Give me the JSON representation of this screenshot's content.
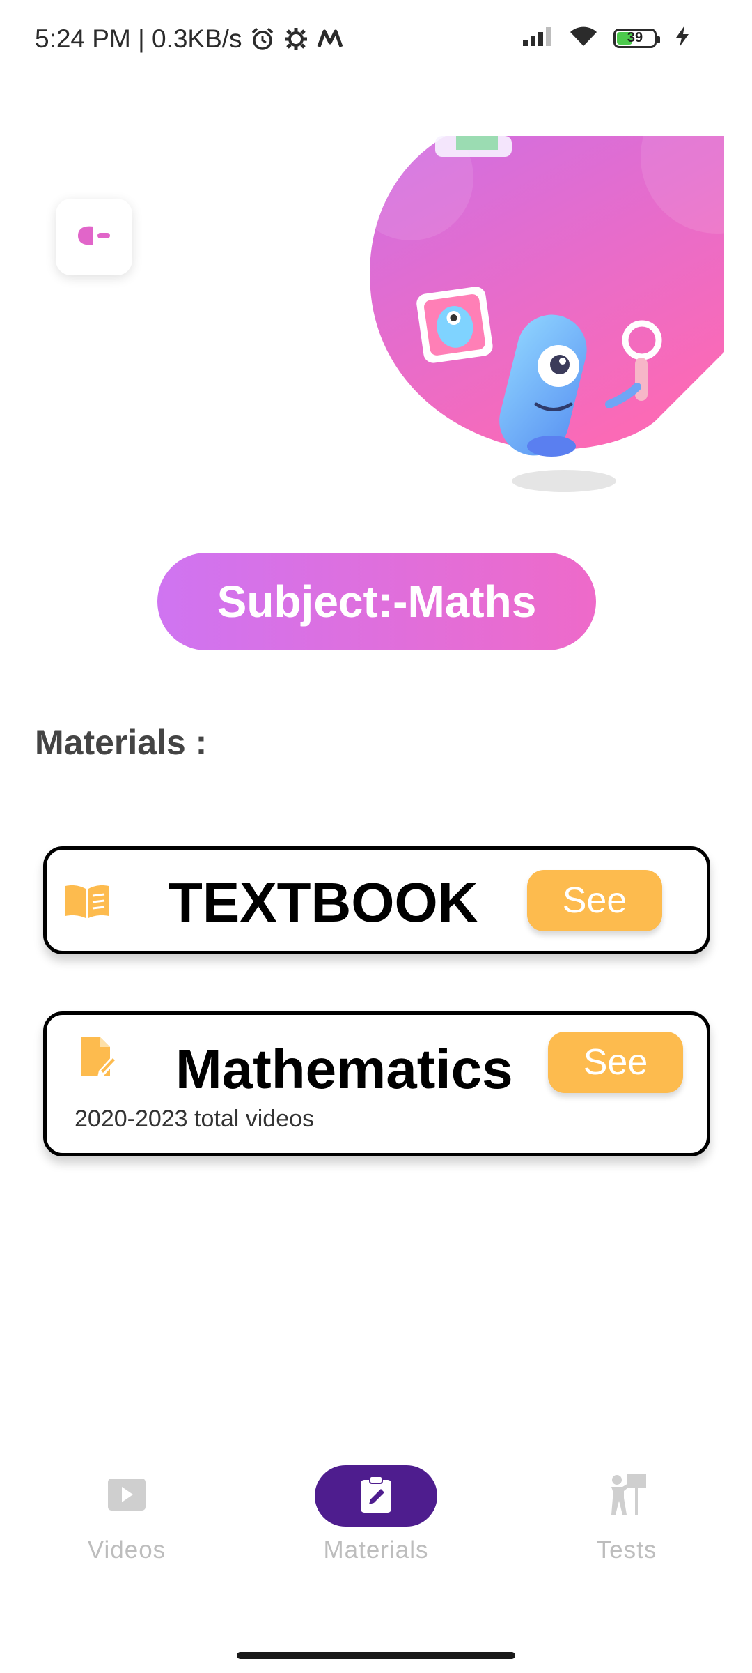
{
  "status_bar": {
    "time": "5:24 PM",
    "speed": "0.3KB/s",
    "battery_level": "39",
    "icons": [
      "alarm-icon",
      "settings-icon",
      "m-app-icon",
      "signal-icon",
      "wifi-icon",
      "battery-icon",
      "charging-icon"
    ]
  },
  "subject": {
    "label": "Subject:-Maths"
  },
  "materials": {
    "heading": "Materials :",
    "items": [
      {
        "title": "TEXTBOOK",
        "icon": "book-icon",
        "button_label": "See",
        "subtitle": ""
      },
      {
        "title": "Mathematics",
        "icon": "document-edit-icon",
        "button_label": "See",
        "subtitle": "2020-2023 total videos"
      }
    ]
  },
  "bottom_nav": {
    "items": [
      {
        "label": "Videos",
        "icon": "play-icon",
        "active": false
      },
      {
        "label": "Materials",
        "icon": "clipboard-edit-icon",
        "active": true
      },
      {
        "label": "Tests",
        "icon": "presenter-icon",
        "active": false
      }
    ]
  },
  "colors": {
    "accent_gradient_start": "#cf74f1",
    "accent_gradient_end": "#ee6ac9",
    "see_button": "#fdbb4e",
    "nav_active": "#4e1d8e",
    "icon_orange": "#fdbb4e",
    "back_arrow": "#e165c9"
  }
}
